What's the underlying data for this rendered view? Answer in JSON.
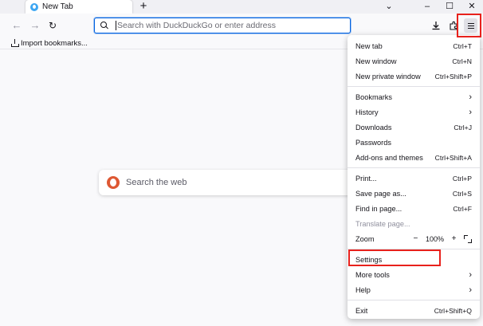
{
  "tab": {
    "title": "New Tab",
    "new_tab_symbol": "+"
  },
  "window_controls": {
    "list_all_tabs": "⌄",
    "minimize": "–",
    "maximize": "☐",
    "close": "✕"
  },
  "nav": {
    "back": "←",
    "forward": "→",
    "reload": "↻"
  },
  "urlbar": {
    "placeholder": "Search with DuckDuckGo or enter address",
    "value": ""
  },
  "bookmarks": {
    "import_label": "Import bookmarks..."
  },
  "content": {
    "search_placeholder": "Search the web"
  },
  "app_menu": {
    "items": [
      {
        "id": "new-tab",
        "label": "New tab",
        "shortcut": "Ctrl+T"
      },
      {
        "id": "new-window",
        "label": "New window",
        "shortcut": "Ctrl+N"
      },
      {
        "id": "new-private-window",
        "label": "New private window",
        "shortcut": "Ctrl+Shift+P"
      },
      {
        "id": "bookmarks",
        "label": "Bookmarks",
        "chevron": "›"
      },
      {
        "id": "history",
        "label": "History",
        "chevron": "›"
      },
      {
        "id": "downloads",
        "label": "Downloads",
        "shortcut": "Ctrl+J"
      },
      {
        "id": "passwords",
        "label": "Passwords"
      },
      {
        "id": "addons",
        "label": "Add-ons and themes",
        "shortcut": "Ctrl+Shift+A"
      },
      {
        "id": "print",
        "label": "Print...",
        "shortcut": "Ctrl+P"
      },
      {
        "id": "save-page",
        "label": "Save page as...",
        "shortcut": "Ctrl+S"
      },
      {
        "id": "find",
        "label": "Find in page...",
        "shortcut": "Ctrl+F"
      },
      {
        "id": "translate",
        "label": "Translate page..."
      },
      {
        "id": "zoom",
        "label": "Zoom",
        "zoom_out": "−",
        "zoom_level": "100%",
        "zoom_in": "+"
      },
      {
        "id": "settings",
        "label": "Settings"
      },
      {
        "id": "more-tools",
        "label": "More tools",
        "chevron": "›"
      },
      {
        "id": "help",
        "label": "Help",
        "chevron": "›"
      },
      {
        "id": "exit",
        "label": "Exit",
        "shortcut": "Ctrl+Shift+Q"
      }
    ]
  },
  "colors": {
    "accent": "#0061e0",
    "highlight": "#e8211c",
    "ddg": "#de5833"
  }
}
